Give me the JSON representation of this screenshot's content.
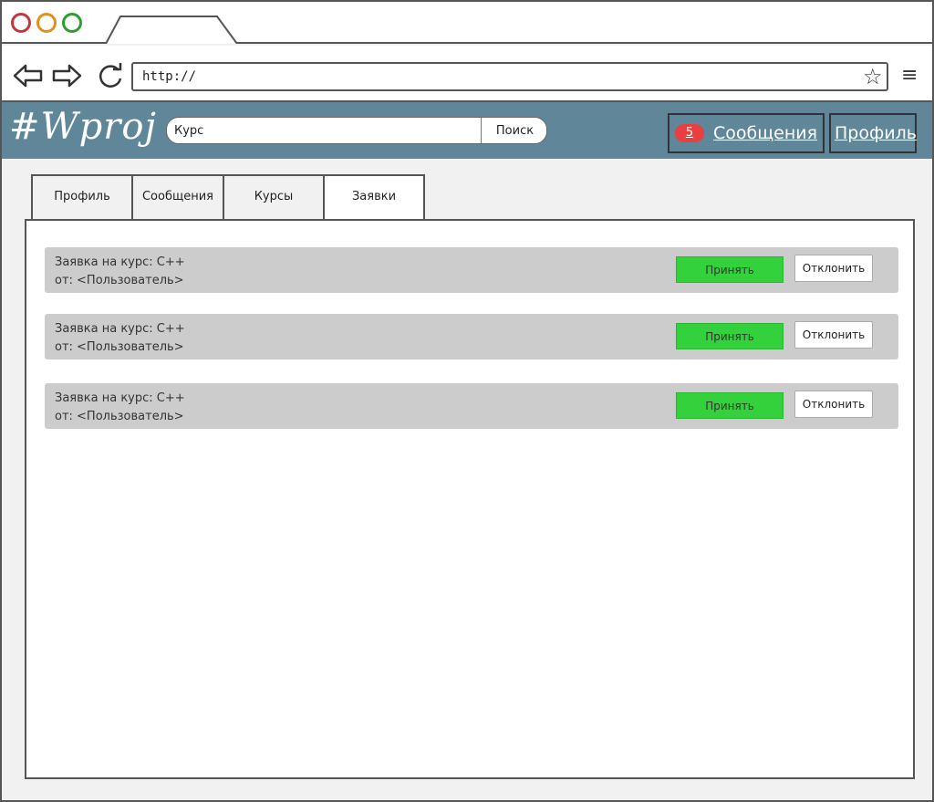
{
  "browser": {
    "url": "http://"
  },
  "app": {
    "logo": "#Wproj",
    "search": {
      "value": "Курс",
      "button_label": "Поиск"
    },
    "messages": {
      "badge_count": "5",
      "label": "Сообщения"
    },
    "profile_label": "Профиль"
  },
  "tabs": [
    {
      "label": "Профиль",
      "active": false
    },
    {
      "label": "Сообщения",
      "active": false
    },
    {
      "label": "Курсы",
      "active": false
    },
    {
      "label": "Заявки",
      "active": true
    }
  ],
  "requests": [
    {
      "title": "Заявка на курс: C++",
      "from": "от: <Пользователь>",
      "accept_label": "Принять",
      "decline_label": "Отклонить"
    },
    {
      "title": "Заявка на курс: C++",
      "from": "от: <Пользователь>",
      "accept_label": "Принять",
      "decline_label": "Отклонить"
    },
    {
      "title": "Заявка на курс: C++",
      "from": "от: <Пользователь>",
      "accept_label": "Принять",
      "decline_label": "Отклонить"
    }
  ],
  "colors": {
    "header_bg": "#5f8799",
    "accept_green": "#33d13b",
    "badge_red": "#e84040",
    "request_row_bg": "#cccccc"
  }
}
